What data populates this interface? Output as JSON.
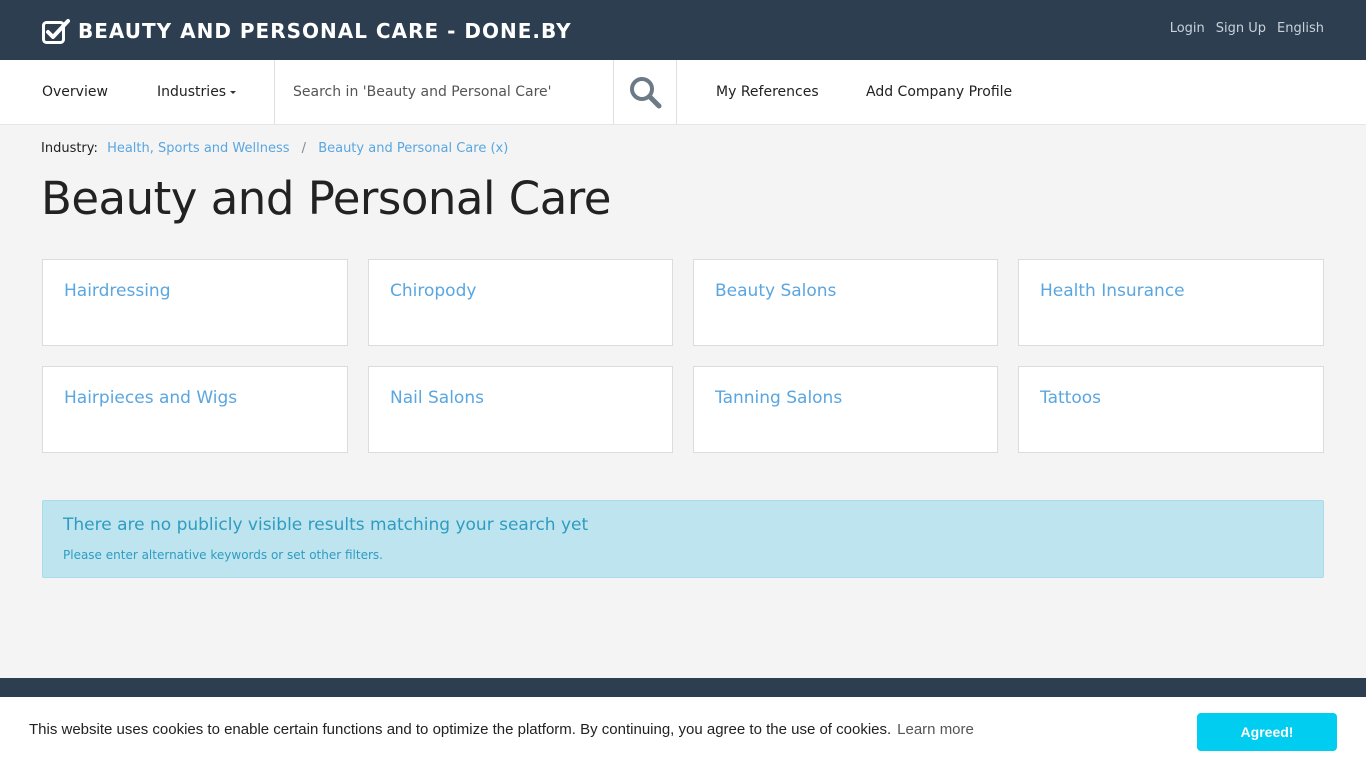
{
  "header": {
    "brand": "BEAUTY AND PERSONAL CARE - DONE.BY",
    "login": "Login",
    "signup": "Sign Up",
    "language": "English"
  },
  "nav": {
    "overview": "Overview",
    "industries": "Industries",
    "search_placeholder": "Search in 'Beauty and Personal Care'",
    "my_references": "My References",
    "add_company_profile": "Add Company Profile",
    "search_icon": "search-icon"
  },
  "breadcrumb": {
    "label": "Industry:",
    "items": [
      "Health, Sports and Wellness",
      "Beauty and Personal Care (x)"
    ],
    "separator": "/"
  },
  "page": {
    "title": "Beauty and Personal Care"
  },
  "categories": [
    "Hairdressing",
    "Chiropody",
    "Beauty Salons",
    "Health Insurance",
    "Hairpieces and Wigs",
    "Nail Salons",
    "Tanning Salons",
    "Tattoos"
  ],
  "alert": {
    "title": "There are no publicly visible results matching your search yet",
    "text": "Please enter alternative keywords or set other filters."
  },
  "cookie": {
    "text": "This website uses cookies to enable certain functions and to optimize the platform. By continuing, you agree to the use of cookies.",
    "learn_more": "Learn more",
    "button": "Agreed!"
  },
  "colors": {
    "header_bg": "#2c3e50",
    "link": "#5aa6e0",
    "alert_bg": "#bee5ef",
    "cookie_button": "#00cdf0"
  }
}
